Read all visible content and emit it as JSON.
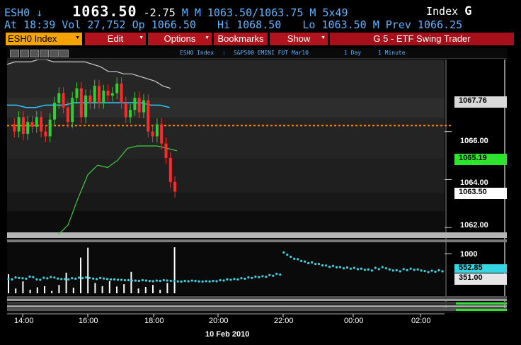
{
  "header": {
    "ticker": "ESH0",
    "arrow": "↓",
    "last": "1063.50",
    "change": "-2.75",
    "flags": "M M",
    "bid_ask": "1063.50/1063.75",
    "bid_ask_flag": "M",
    "size": "5x49",
    "index_label": "Index",
    "index_code": "G"
  },
  "stats": {
    "time": "At 18:39",
    "vol": "Vol 27,752",
    "open": "Op 1066.50",
    "hi": "Hi 1068.50",
    "lo": "Lo 1063.50",
    "prev": "M Prev 1066.25"
  },
  "menu": {
    "security": "ESH0 Index",
    "edit": "Edit",
    "options": "Options",
    "bookmarks": "Bookmarks",
    "show": "Show",
    "title": "G 5 - ETF Swing Trader"
  },
  "toolbar": {
    "ticker": "ESH0 Index",
    "colon": ":",
    "name": "S&P500 EMINI FUT Mar10",
    "period": "1 Day",
    "interval": "1 Minute"
  },
  "colors": {
    "up": "#33cc33",
    "down": "#ff2a2a",
    "bollinger": "#cfcfcf",
    "ma": "#2ec8ff",
    "trend": "#39d13a",
    "prevclose": "#ff8a00",
    "volume": "#ffffff",
    "vol_dots": "#35d6e3"
  },
  "price_axis": {
    "ticks": [
      "1067.76",
      "1066.00",
      "1065.19",
      "1064.00",
      "1063.50",
      "1062.00"
    ]
  },
  "volume_axis": {
    "ticks": [
      "1000",
      "552.85",
      "351.00"
    ]
  },
  "x_axis": {
    "ticks": [
      "14:00",
      "16:00",
      "18:00",
      "20:00",
      "22:00",
      "00:00",
      "02:00"
    ],
    "date": "10 Feb 2010"
  },
  "chart_data": {
    "type": "line",
    "ylim": [
      1061.8,
      1069.0
    ],
    "price_path": [
      1066.3,
      1066.0,
      1066.6,
      1065.9,
      1066.4,
      1066.2,
      1066.6,
      1066.0,
      1065.8,
      1066.5,
      1067.2,
      1067.6,
      1067.0,
      1066.4,
      1067.4,
      1067.8,
      1066.6,
      1067.5,
      1067.2,
      1067.9,
      1067.2,
      1067.7,
      1067.5,
      1067.6,
      1068.0,
      1067.2,
      1066.6,
      1066.9,
      1067.4,
      1066.8,
      1067.3,
      1066.0,
      1065.8,
      1066.3,
      1065.5,
      1064.9,
      1063.9,
      1063.5
    ],
    "bollinger_upper": [
      1068.8,
      1068.9,
      1068.9,
      1068.9,
      1069.0,
      1069.0,
      1068.9,
      1068.9,
      1068.9,
      1068.9,
      1068.9,
      1068.8,
      1068.7,
      1068.5,
      1068.5,
      1068.4,
      1068.4,
      1068.3,
      1068.2,
      1068.1,
      1067.9,
      1067.8
    ],
    "ma": [
      1067.1,
      1067.1,
      1067.0,
      1067.0,
      1067.1,
      1067.1,
      1067.1,
      1067.2,
      1067.2,
      1067.2,
      1067.2,
      1067.2,
      1067.2,
      1067.2,
      1067.2,
      1067.1,
      1067.1,
      1067.0
    ],
    "prev_close": 1066.25,
    "trend_line": [
      1061.7,
      1062.1,
      1063.2,
      1064.2,
      1064.6,
      1064.5,
      1064.8,
      1065.3,
      1065.4,
      1065.4,
      1065.4,
      1065.3,
      1065.2
    ],
    "volume_bars": [
      480,
      120,
      300,
      90,
      150,
      180,
      60,
      210,
      520,
      140,
      900,
      1150,
      260,
      180,
      310,
      170,
      230,
      540,
      120,
      160,
      210,
      90,
      260,
      1160
    ],
    "volume_dots": [
      360,
      400,
      380,
      420,
      350,
      390,
      410,
      370,
      360,
      380,
      395,
      400,
      370,
      385,
      360,
      350,
      340,
      330,
      320,
      330,
      310,
      320,
      330,
      315,
      300,
      310,
      320,
      300,
      305,
      310,
      330,
      350,
      360,
      380,
      400,
      420,
      430,
      460,
      490,
      1030,
      920,
      860,
      800,
      780,
      740,
      700,
      690,
      660,
      650,
      640,
      620,
      600,
      640,
      660,
      600,
      580,
      610,
      620,
      600,
      560,
      570,
      580
    ]
  }
}
